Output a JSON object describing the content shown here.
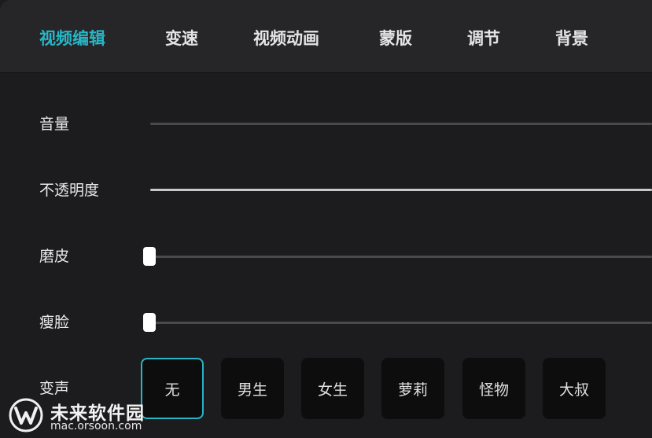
{
  "tabs": [
    {
      "label": "视频编辑",
      "active": true
    },
    {
      "label": "变速",
      "active": false
    },
    {
      "label": "视频动画",
      "active": false
    },
    {
      "label": "蒙版",
      "active": false
    },
    {
      "label": "调节",
      "active": false
    },
    {
      "label": "背景",
      "active": false
    }
  ],
  "accent_color": "#26b7c7",
  "settings": {
    "volume": {
      "label": "音量"
    },
    "opacity": {
      "label": "不透明度"
    },
    "smooth_skin": {
      "label": "磨皮",
      "value": 0
    },
    "face_slim": {
      "label": "瘦脸",
      "value": 0
    },
    "voice_change": {
      "label": "变声",
      "options": [
        "无",
        "男生",
        "女生",
        "萝莉",
        "怪物",
        "大叔"
      ],
      "selected": "无"
    }
  },
  "watermark": {
    "title": "未来软件园",
    "url": "mac.orsoon.com",
    "icon": "wm-logo-icon"
  }
}
